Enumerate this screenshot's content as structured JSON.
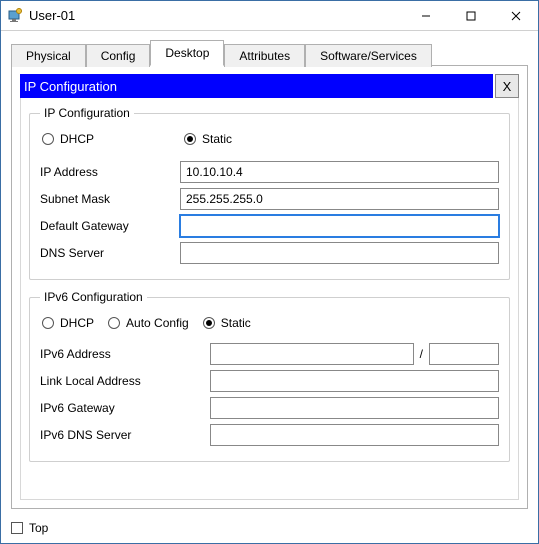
{
  "window": {
    "title": "User-01"
  },
  "tabs": {
    "t0": "Physical",
    "t1": "Config",
    "t2": "Desktop",
    "t3": "Attributes",
    "t4": "Software/Services",
    "active": "Desktop"
  },
  "panel": {
    "title": "IP Configuration",
    "close": "X"
  },
  "ipv4": {
    "legend": "IP Configuration",
    "mode_dhcp": "DHCP",
    "mode_static": "Static",
    "mode_selected": "Static",
    "ip_label": "IP Address",
    "ip_value": "10.10.10.4",
    "mask_label": "Subnet Mask",
    "mask_value": "255.255.255.0",
    "gw_label": "Default Gateway",
    "gw_value": "",
    "dns_label": "DNS Server",
    "dns_value": ""
  },
  "ipv6": {
    "legend": "IPv6 Configuration",
    "mode_dhcp": "DHCP",
    "mode_auto": "Auto Config",
    "mode_static": "Static",
    "mode_selected": "Static",
    "addr_label": "IPv6 Address",
    "addr_value": "",
    "prefix_separator": "/",
    "prefix_value": "",
    "ll_label": "Link Local Address",
    "ll_value": "",
    "gw_label": "IPv6 Gateway",
    "gw_value": "",
    "dns_label": "IPv6 DNS Server",
    "dns_value": ""
  },
  "footer": {
    "top_label": "Top",
    "top_checked": false
  }
}
